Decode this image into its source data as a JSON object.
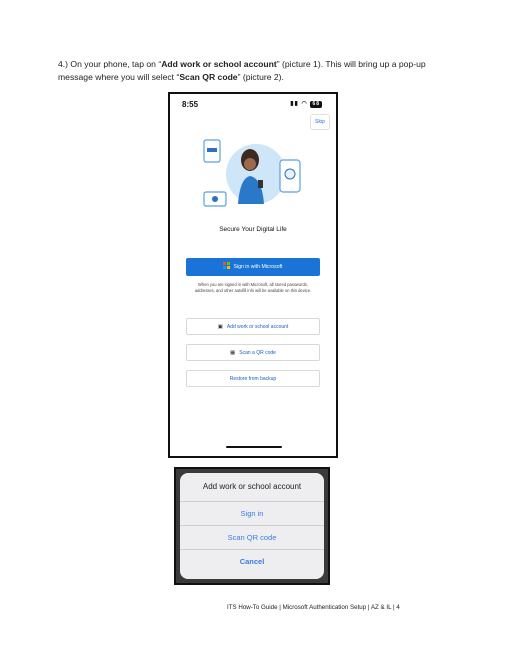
{
  "instruction": {
    "p1": "4.) On your phone, tap on “",
    "bold1": "Add work or school account",
    "p2": "” (picture 1). This will bring up a pop-up message where you will select “",
    "bold2": "Scan QR code",
    "p3": "” (picture 2)."
  },
  "phone": {
    "time": "8:55",
    "battery": "68",
    "skip": "Skip",
    "headline": "Secure Your Digital Life",
    "signin_button": "Sign in with Microsoft",
    "note": "When you are signed in with Microsoft, all stored passwords, addresses, and other autofill info will be available on this device.",
    "add_account": "Add work or school account",
    "scan_qr": "Scan a QR code",
    "restore": "Restore from backup"
  },
  "popup": {
    "title": "Add work or school account",
    "options": [
      "Sign in",
      "Scan QR code",
      "Cancel"
    ]
  },
  "footer": "ITS How-To Guide | Microsoft Authentication Setup | AZ & IL | 4",
  "colors": {
    "accent": "#1a73d6",
    "link_blue": "#3b7de0"
  }
}
